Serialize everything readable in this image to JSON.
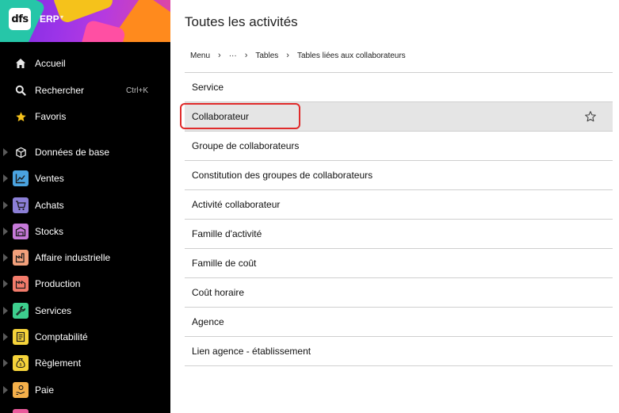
{
  "app": {
    "logo": "dfs",
    "name": "ERP"
  },
  "sidebar": {
    "items": [
      {
        "label": "Accueil",
        "icon": "home-icon"
      },
      {
        "label": "Rechercher",
        "icon": "search-icon",
        "shortcut": "Ctrl+K"
      },
      {
        "label": "Favoris",
        "icon": "star-icon"
      },
      {
        "label": "Données de base",
        "icon": "cube-icon"
      },
      {
        "label": "Ventes",
        "icon": "chart-line-icon",
        "color": "#4aa3df"
      },
      {
        "label": "Achats",
        "icon": "cart-icon",
        "color": "#8b7fd6"
      },
      {
        "label": "Stocks",
        "icon": "warehouse-icon",
        "color": "#c679d9"
      },
      {
        "label": "Affaire industrielle",
        "icon": "factory-icon",
        "color": "#f2a07b"
      },
      {
        "label": "Production",
        "icon": "production-icon",
        "color": "#f27b6b"
      },
      {
        "label": "Services",
        "icon": "wrench-icon",
        "color": "#3dcf8e"
      },
      {
        "label": "Comptabilité",
        "icon": "ledger-icon",
        "color": "#f5d33a"
      },
      {
        "label": "Règlement",
        "icon": "money-bag-icon",
        "color": "#f5d33a"
      },
      {
        "label": "Paie",
        "icon": "hand-coin-icon",
        "color": "#f5b04a"
      }
    ]
  },
  "main": {
    "title": "Toutes les activités",
    "breadcrumb": [
      "Menu",
      "···",
      "Tables",
      "Tables liées aux collaborateurs"
    ],
    "rows": [
      "Service",
      "Collaborateur",
      "Groupe de collaborateurs",
      "Constitution des groupes de collaborateurs",
      "Activité collaborateur",
      "Famille d'activité",
      "Famille de coût",
      "Coût horaire",
      "Agence",
      "Lien agence - établissement"
    ],
    "selected_index": 1
  },
  "colors": {
    "highlight": "#e02b2b",
    "selected_row": "#e5e5e5",
    "sidebar_bg": "#000000"
  }
}
